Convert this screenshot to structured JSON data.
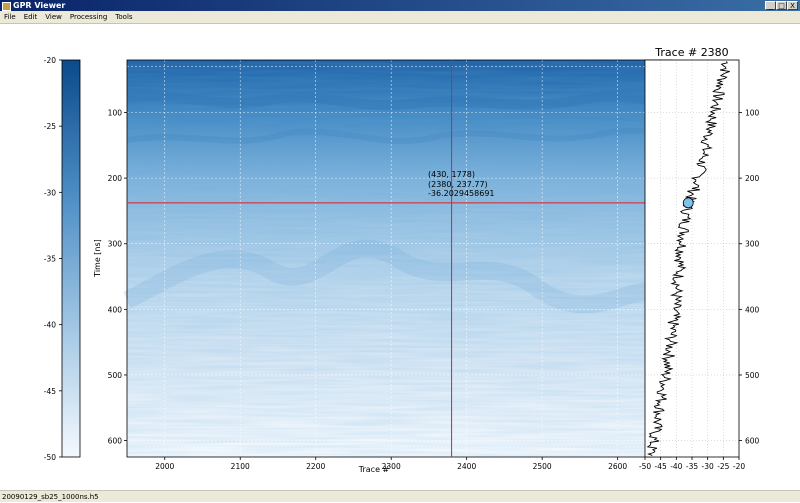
{
  "window": {
    "title": "GPR Viewer",
    "min": "_",
    "max": "□",
    "close": "X"
  },
  "menu": [
    "File",
    "Edit",
    "View",
    "Processing",
    "Tools"
  ],
  "colorbar": {
    "ticks": [
      "-20",
      "-25",
      "-30",
      "-35",
      "-40",
      "-45",
      "-50"
    ],
    "range": [
      -50,
      -20
    ]
  },
  "radargram": {
    "xlabel": "Trace #",
    "ylabel": "Time [ns]",
    "xticks": [
      "2000",
      "2100",
      "2200",
      "2300",
      "2400",
      "2500",
      "2600"
    ],
    "yticks": [
      "100",
      "200",
      "300",
      "400",
      "500",
      "600"
    ],
    "xrange": [
      1950,
      2672
    ],
    "yrange": [
      20,
      625
    ],
    "crosshair": {
      "trace": 2380,
      "time": 237.77
    },
    "annotation": [
      "(430, 1778)",
      "(2380, 237.77)",
      "-36.2029458691"
    ],
    "colors": {
      "crosshair": "#e02020",
      "deep": "#1f63a8",
      "light": "#f4f9fe"
    }
  },
  "trace": {
    "title": "Trace # 2380",
    "xticks": [
      "-50",
      "-45",
      "-40",
      "-35",
      "-30",
      "-25",
      "-20"
    ],
    "yticks": [
      "100",
      "200",
      "300",
      "400",
      "500",
      "600"
    ],
    "marker": {
      "amplitude": -36.2,
      "time": 237.77
    },
    "colors": {
      "marker": "#7ec4e8"
    }
  },
  "chart_data": {
    "type": "line",
    "title": "Trace # 2380",
    "xlabel": "",
    "ylabel": "",
    "xlim": [
      -50,
      -20
    ],
    "ylim": [
      625,
      20
    ],
    "x": [
      -24,
      -26,
      -28,
      -30,
      -32,
      -33.5,
      -35,
      -36.2,
      -37,
      -38,
      -39,
      -40,
      -41,
      -42,
      -44,
      -46,
      -48
    ],
    "y": [
      30,
      60,
      100,
      140,
      180,
      210,
      225,
      237.77,
      260,
      300,
      340,
      380,
      420,
      460,
      520,
      570,
      615
    ]
  },
  "status": {
    "file": "20090129_sb25_1000ns.h5"
  }
}
